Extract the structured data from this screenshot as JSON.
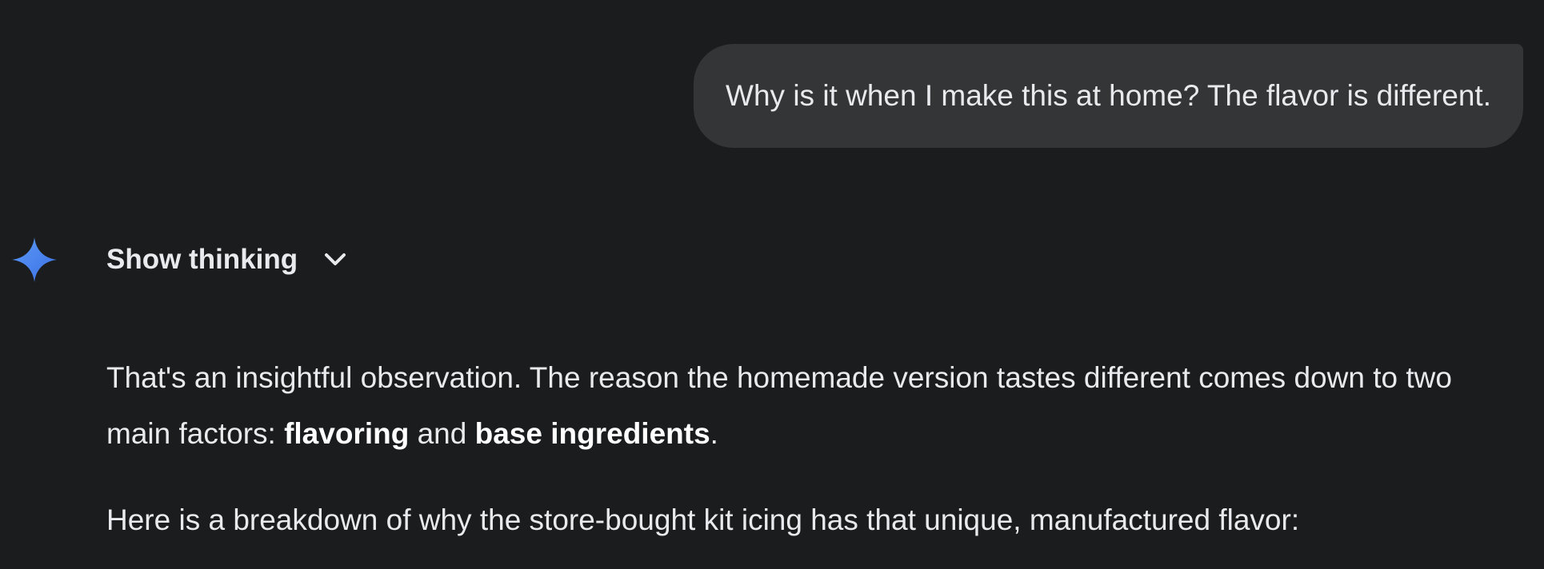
{
  "user_message": {
    "text": "Why is it when I make this at home? The flavor is different."
  },
  "assistant": {
    "icon": "gemini-sparkle-icon",
    "show_thinking_label": "Show thinking",
    "toggle_icon": "chevron-down-icon",
    "paragraph1": {
      "part1": "That's an insightful observation. The reason the homemade version tastes different comes down to two main factors: ",
      "bold1": "flavoring",
      "part2": " and ",
      "bold2": "base ingredients",
      "part3": "."
    },
    "paragraph2": "Here is a breakdown of why the store-bought kit icing has that unique, manufactured flavor:"
  },
  "colors": {
    "background": "#1b1c1e",
    "user_bubble": "#333537",
    "text": "#e8eaed",
    "gemini_blue_start": "#4f8df5",
    "gemini_blue_end": "#3b6fe0"
  }
}
